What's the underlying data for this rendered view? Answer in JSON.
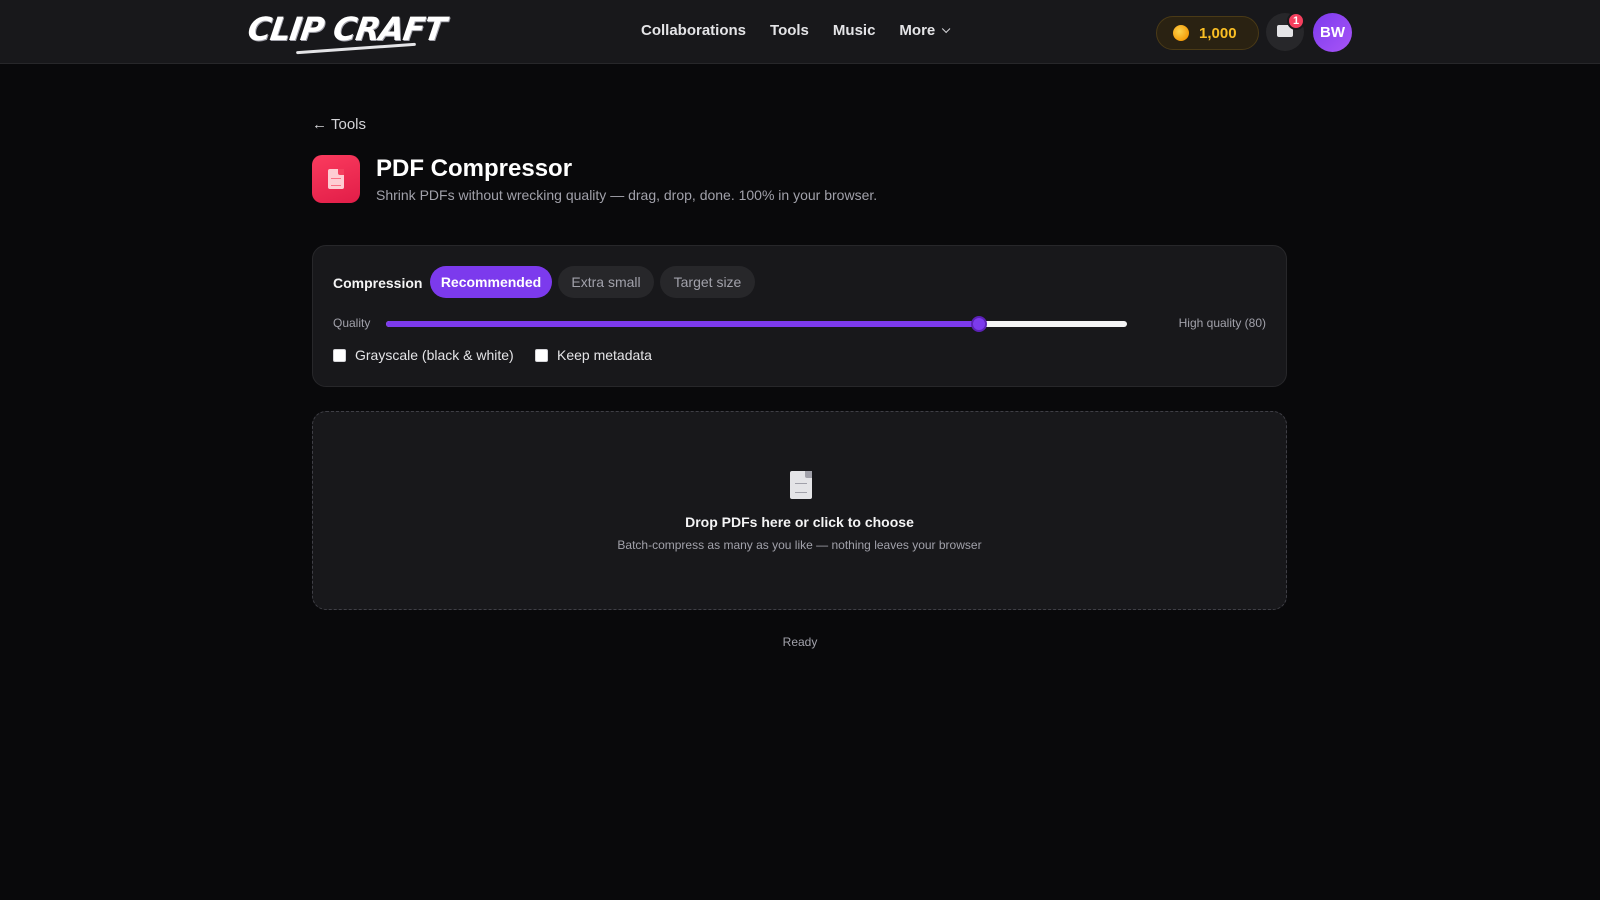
{
  "header": {
    "logo": "CLIP CRAFT",
    "nav": [
      "Collaborations",
      "Tools",
      "Music",
      "More"
    ],
    "coins": "1,000",
    "inbox_badge": "1",
    "avatar_initials": "BW"
  },
  "breadcrumb": {
    "back_label": "Tools",
    "arrow": "←"
  },
  "tool": {
    "title": "PDF Compressor",
    "subtitle": "Shrink PDFs without wrecking quality — drag, drop, done. 100% in your browser.",
    "icon": "document-icon"
  },
  "settings": {
    "compression_label": "Compression",
    "modes": [
      "Recommended",
      "Extra small",
      "Target size"
    ],
    "selected_mode": "Recommended",
    "quality_label": "Quality",
    "quality_value": 80,
    "quality_readout": "High quality (80)",
    "options": [
      {
        "label": "Grayscale (black & white)",
        "checked": false
      },
      {
        "label": "Keep metadata",
        "checked": false
      }
    ]
  },
  "dropzone": {
    "title": "Drop PDFs here or click to choose",
    "subtitle": "Batch-compress as many as you like — nothing leaves your browser"
  },
  "status": "Ready",
  "colors": {
    "accent": "#7c3aed",
    "tool_icon": "#e11d48",
    "coin": "#fbbf24",
    "background": "#09090b"
  }
}
